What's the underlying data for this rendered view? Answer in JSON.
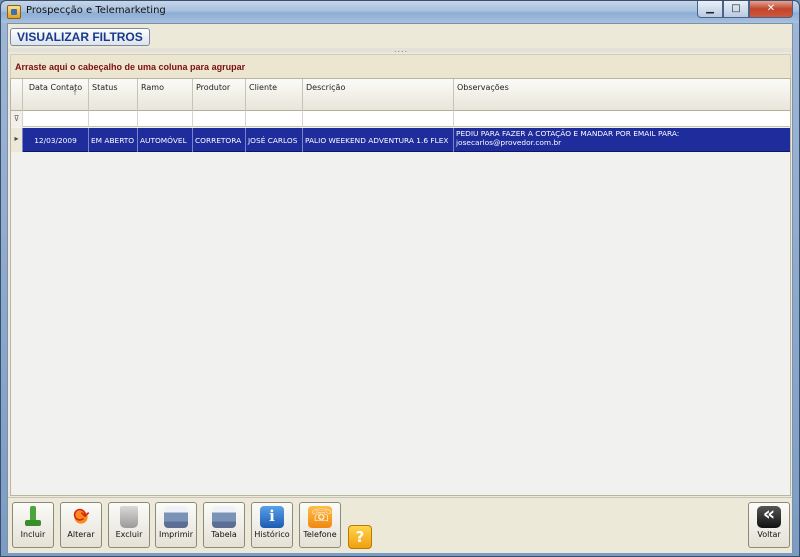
{
  "window": {
    "title": "Prospecção e Telemarketing",
    "minimize": "▁",
    "maximize": "□",
    "close": "✕"
  },
  "panel": {
    "filter_title": "VISUALIZAR FILTROS",
    "splitter_grip": "....",
    "group_hint": "Arraste aqui o cabeçalho de uma coluna para agrupar"
  },
  "grid": {
    "columns": [
      "Data Contato",
      "Status",
      "Ramo",
      "Produtor",
      "Cliente",
      "Descrição",
      "Observações"
    ],
    "sort_indicator": "↑",
    "filter_icon": "⊽",
    "row_indicator": "▸",
    "rows": [
      {
        "data_contato": "12/03/2009",
        "status": "EM ABERTO",
        "ramo": "AUTOMÓVEL",
        "produtor": "CORRETORA",
        "cliente": "JOSÉ CARLOS",
        "descricao": "PALIO WEEKEND ADVENTURA 1.6 FLEX",
        "observacoes_line1": "PEDIU PARA FAZER A COTAÇÃO E MANDAR POR EMAIL PARA:",
        "observacoes_line2": "josecarlos@provedor.com.br"
      }
    ]
  },
  "toolbar": {
    "incluir": "Incluir",
    "alterar": "Alterar",
    "excluir": "Excluir",
    "imprimir": "Imprimir",
    "tabela": "Tabela",
    "historico": "Histórico",
    "telefone": "Telefone",
    "help": "?",
    "voltar": "Voltar"
  }
}
